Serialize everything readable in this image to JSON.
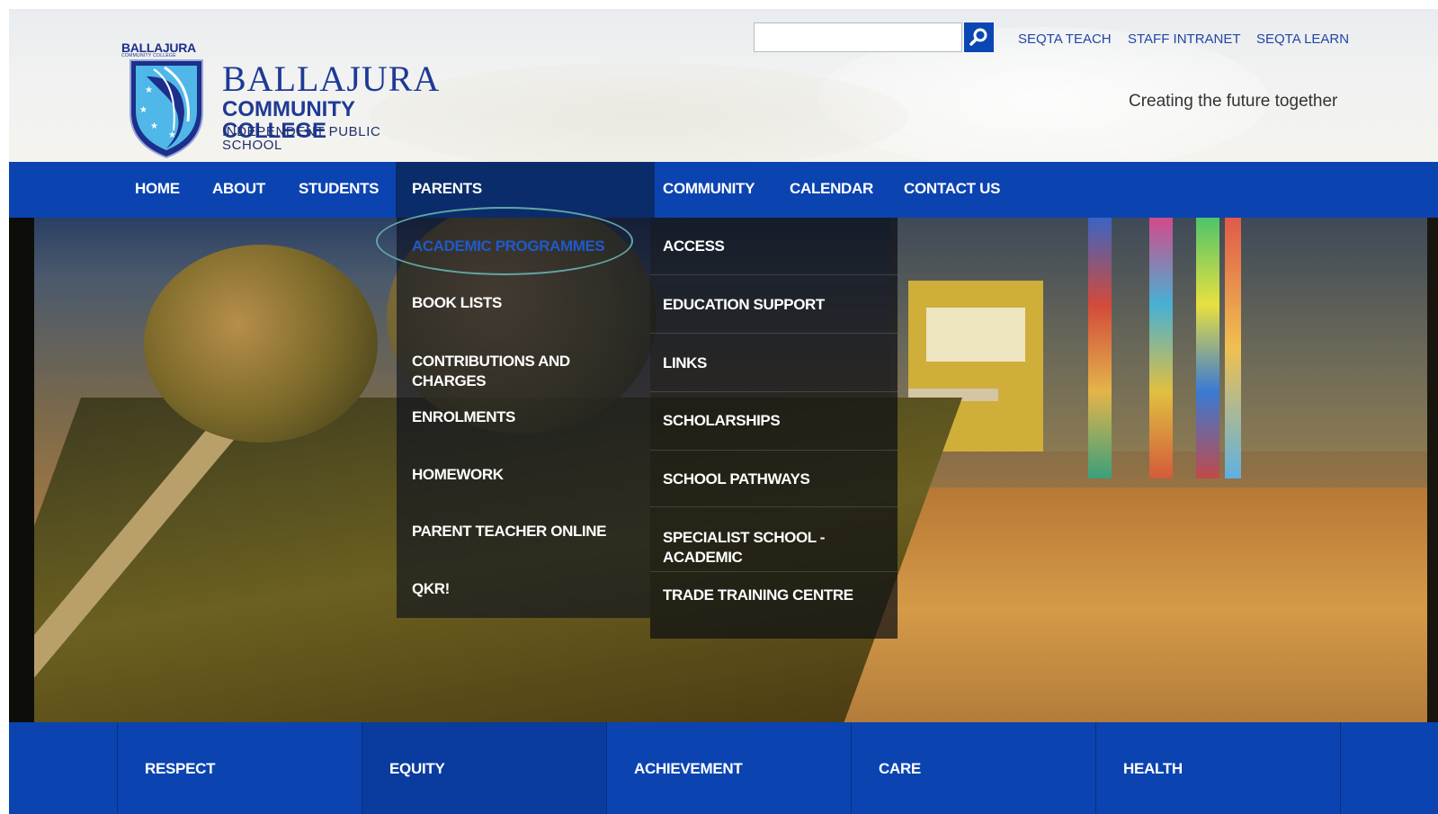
{
  "header": {
    "logo": {
      "crest_label": "BALLAJURA",
      "crest_sub": "COMMUNITY COLLEGE",
      "title": "BALLAJURA",
      "subtitle1": "COMMUNITY COLLEGE",
      "subtitle2": "INDEPENDENT PUBLIC SCHOOL"
    },
    "search": {
      "placeholder": "",
      "button_icon": "search-icon"
    },
    "links": [
      "SEQTA TEACH",
      "STAFF INTRANET",
      "SEQTA LEARN"
    ],
    "tagline": "Creating the future together"
  },
  "nav": {
    "items": [
      "HOME",
      "ABOUT",
      "STUDENTS",
      "PARENTS",
      "COMMUNITY",
      "CALENDAR",
      "CONTACT US"
    ],
    "active": "PARENTS"
  },
  "dropdown": {
    "col1": [
      "ACADEMIC PROGRAMMES",
      "BOOK LISTS",
      "CONTRIBUTIONS AND CHARGES",
      "ENROLMENTS",
      "HOMEWORK",
      "PARENT TEACHER ONLINE",
      "QKR!"
    ],
    "col2": [
      "ACCESS",
      "EDUCATION SUPPORT",
      "LINKS",
      "SCHOLARSHIPS",
      "SCHOOL PATHWAYS",
      "SPECIALIST SCHOOL - ACADEMIC",
      "TRADE TRAINING CENTRE"
    ],
    "highlighted": "ACADEMIC PROGRAMMES"
  },
  "values": [
    "RESPECT",
    "EQUITY",
    "ACHIEVEMENT",
    "CARE",
    "HEALTH"
  ],
  "colors": {
    "primary_blue": "#0b44b1",
    "dark_navy": "#0a2c6b",
    "link_blue": "#2246a6",
    "annotation": "#63a5a5"
  }
}
